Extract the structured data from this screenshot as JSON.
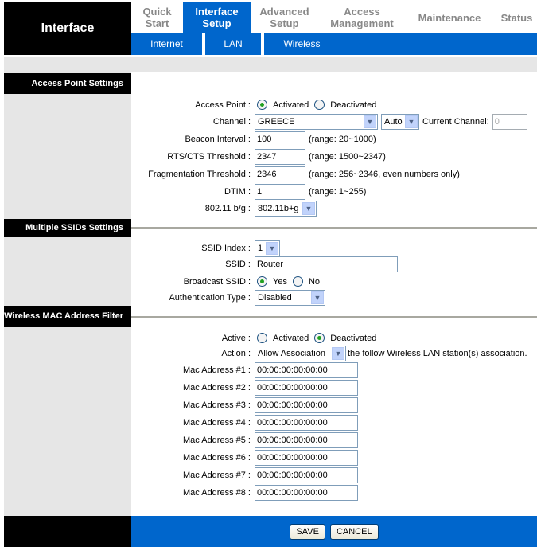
{
  "brand": "Interface",
  "tabs": [
    {
      "label1": "Quick",
      "label2": "Start"
    },
    {
      "label1": "Interface",
      "label2": "Setup"
    },
    {
      "label1": "Advanced",
      "label2": "Setup"
    },
    {
      "label1": "Access",
      "label2": "Management"
    },
    {
      "label1": "Maintenance",
      "label2": ""
    },
    {
      "label1": "Status",
      "label2": ""
    }
  ],
  "subtabs": [
    "Internet",
    "LAN",
    "Wireless"
  ],
  "colors": {
    "accent": "#0066cc",
    "header_bg": "#000000",
    "sidebar_bg": "#e6e6e6"
  },
  "ap": {
    "title": "Access Point Settings",
    "access_point": {
      "label": "Access Point :",
      "opt1": "Activated",
      "opt2": "Deactivated",
      "selected": "Activated"
    },
    "channel": {
      "label": "Channel :",
      "country": "GREECE",
      "channel": "Auto",
      "current_label": "Current Channel:",
      "current_value": "0"
    },
    "beacon": {
      "label": "Beacon Interval :",
      "value": "100",
      "hint": "(range: 20~1000)"
    },
    "rts": {
      "label": "RTS/CTS Threshold :",
      "value": "2347",
      "hint": "(range: 1500~2347)"
    },
    "frag": {
      "label": "Fragmentation Threshold :",
      "value": "2346",
      "hint": "(range: 256~2346, even numbers only)"
    },
    "dtim": {
      "label": "DTIM :",
      "value": "1",
      "hint": "(range: 1~255)"
    },
    "mode": {
      "label": "802.11 b/g :",
      "value": "802.11b+g"
    }
  },
  "ssid": {
    "title": "Multiple SSIDs Settings",
    "index": {
      "label": "SSID Index :",
      "value": "1"
    },
    "ssid": {
      "label": "SSID :",
      "value": "Router"
    },
    "broadcast": {
      "label": "Broadcast SSID :",
      "opt1": "Yes",
      "opt2": "No",
      "selected": "Yes"
    },
    "auth": {
      "label": "Authentication Type :",
      "value": "Disabled"
    }
  },
  "mac": {
    "title": "Wireless MAC Address Filter",
    "active": {
      "label": "Active :",
      "opt1": "Activated",
      "opt2": "Deactivated",
      "selected": "Deactivated"
    },
    "action": {
      "label": "Action :",
      "value": "Allow Association",
      "suffix": "the follow Wireless LAN station(s) association."
    },
    "addresses": [
      {
        "label": "Mac Address #1 :",
        "value": "00:00:00:00:00:00"
      },
      {
        "label": "Mac Address #2 :",
        "value": "00:00:00:00:00:00"
      },
      {
        "label": "Mac Address #3 :",
        "value": "00:00:00:00:00:00"
      },
      {
        "label": "Mac Address #4 :",
        "value": "00:00:00:00:00:00"
      },
      {
        "label": "Mac Address #5 :",
        "value": "00:00:00:00:00:00"
      },
      {
        "label": "Mac Address #6 :",
        "value": "00:00:00:00:00:00"
      },
      {
        "label": "Mac Address #7 :",
        "value": "00:00:00:00:00:00"
      },
      {
        "label": "Mac Address #8 :",
        "value": "00:00:00:00:00:00"
      }
    ]
  },
  "footer": {
    "save": "SAVE",
    "cancel": "CANCEL"
  }
}
